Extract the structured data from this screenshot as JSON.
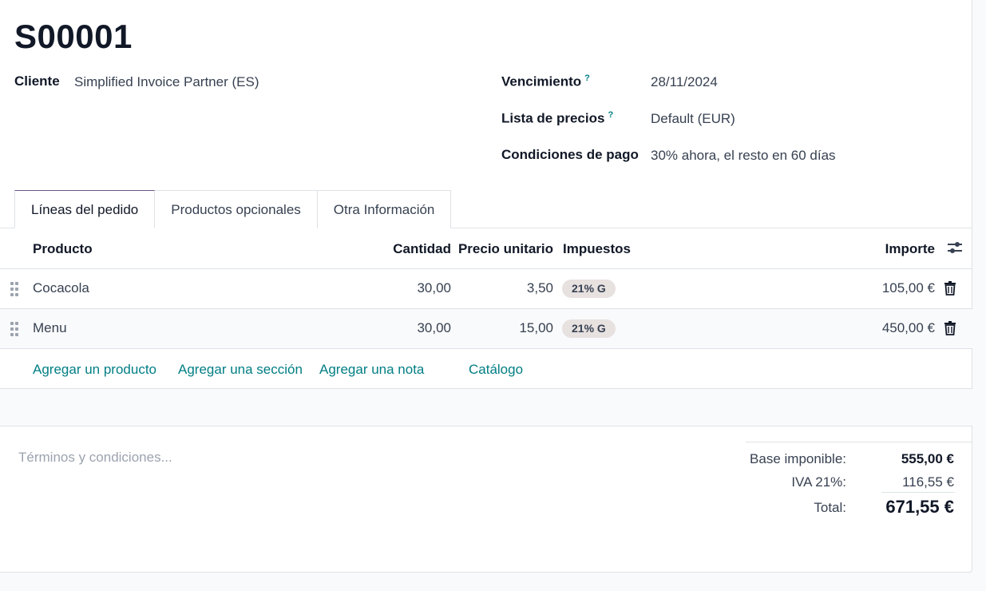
{
  "record": {
    "title": "S00001"
  },
  "fields": {
    "cliente": {
      "label": "Cliente",
      "value": "Simplified Invoice Partner (ES)"
    },
    "vencimiento": {
      "label": "Vencimiento",
      "help": "?",
      "value": "28/11/2024"
    },
    "lista_precios": {
      "label": "Lista de precios",
      "help": "?",
      "value": "Default (EUR)"
    },
    "condiciones_pago": {
      "label": "Condiciones de pago",
      "value": "30% ahora, el resto en 60 días"
    }
  },
  "tabs": [
    {
      "label": "Líneas del pedido",
      "active": true
    },
    {
      "label": "Productos opcionales",
      "active": false
    },
    {
      "label": "Otra Información",
      "active": false
    }
  ],
  "table": {
    "headers": {
      "producto": "Producto",
      "cantidad": "Cantidad",
      "precio": "Precio unitario",
      "impuestos": "Impuestos",
      "importe": "Importe"
    },
    "rows": [
      {
        "producto": "Cocacola",
        "cantidad": "30,00",
        "precio": "3,50",
        "impuesto": "21% G",
        "importe": "105,00 €"
      },
      {
        "producto": "Menu",
        "cantidad": "30,00",
        "precio": "15,00",
        "impuesto": "21% G",
        "importe": "450,00 €"
      }
    ],
    "actions": {
      "add_product": "Agregar un producto",
      "add_section": "Agregar una sección",
      "add_note": "Agregar una nota",
      "catalog": "Catálogo"
    }
  },
  "terms": {
    "placeholder": "Términos y condiciones..."
  },
  "totals": {
    "base_label": "Base imponible:",
    "base_value": "555,00 €",
    "iva_label": "IVA 21%:",
    "iva_value": "116,55 €",
    "total_label": "Total:",
    "total_value": "671,55 €"
  },
  "colors": {
    "link": "#017e84",
    "active_tab": "#6c5486",
    "badge_bg": "#e7e1e0"
  },
  "icons": [
    "drag-handle-icon",
    "trash-icon",
    "column-settings-icon",
    "help-icon"
  ]
}
